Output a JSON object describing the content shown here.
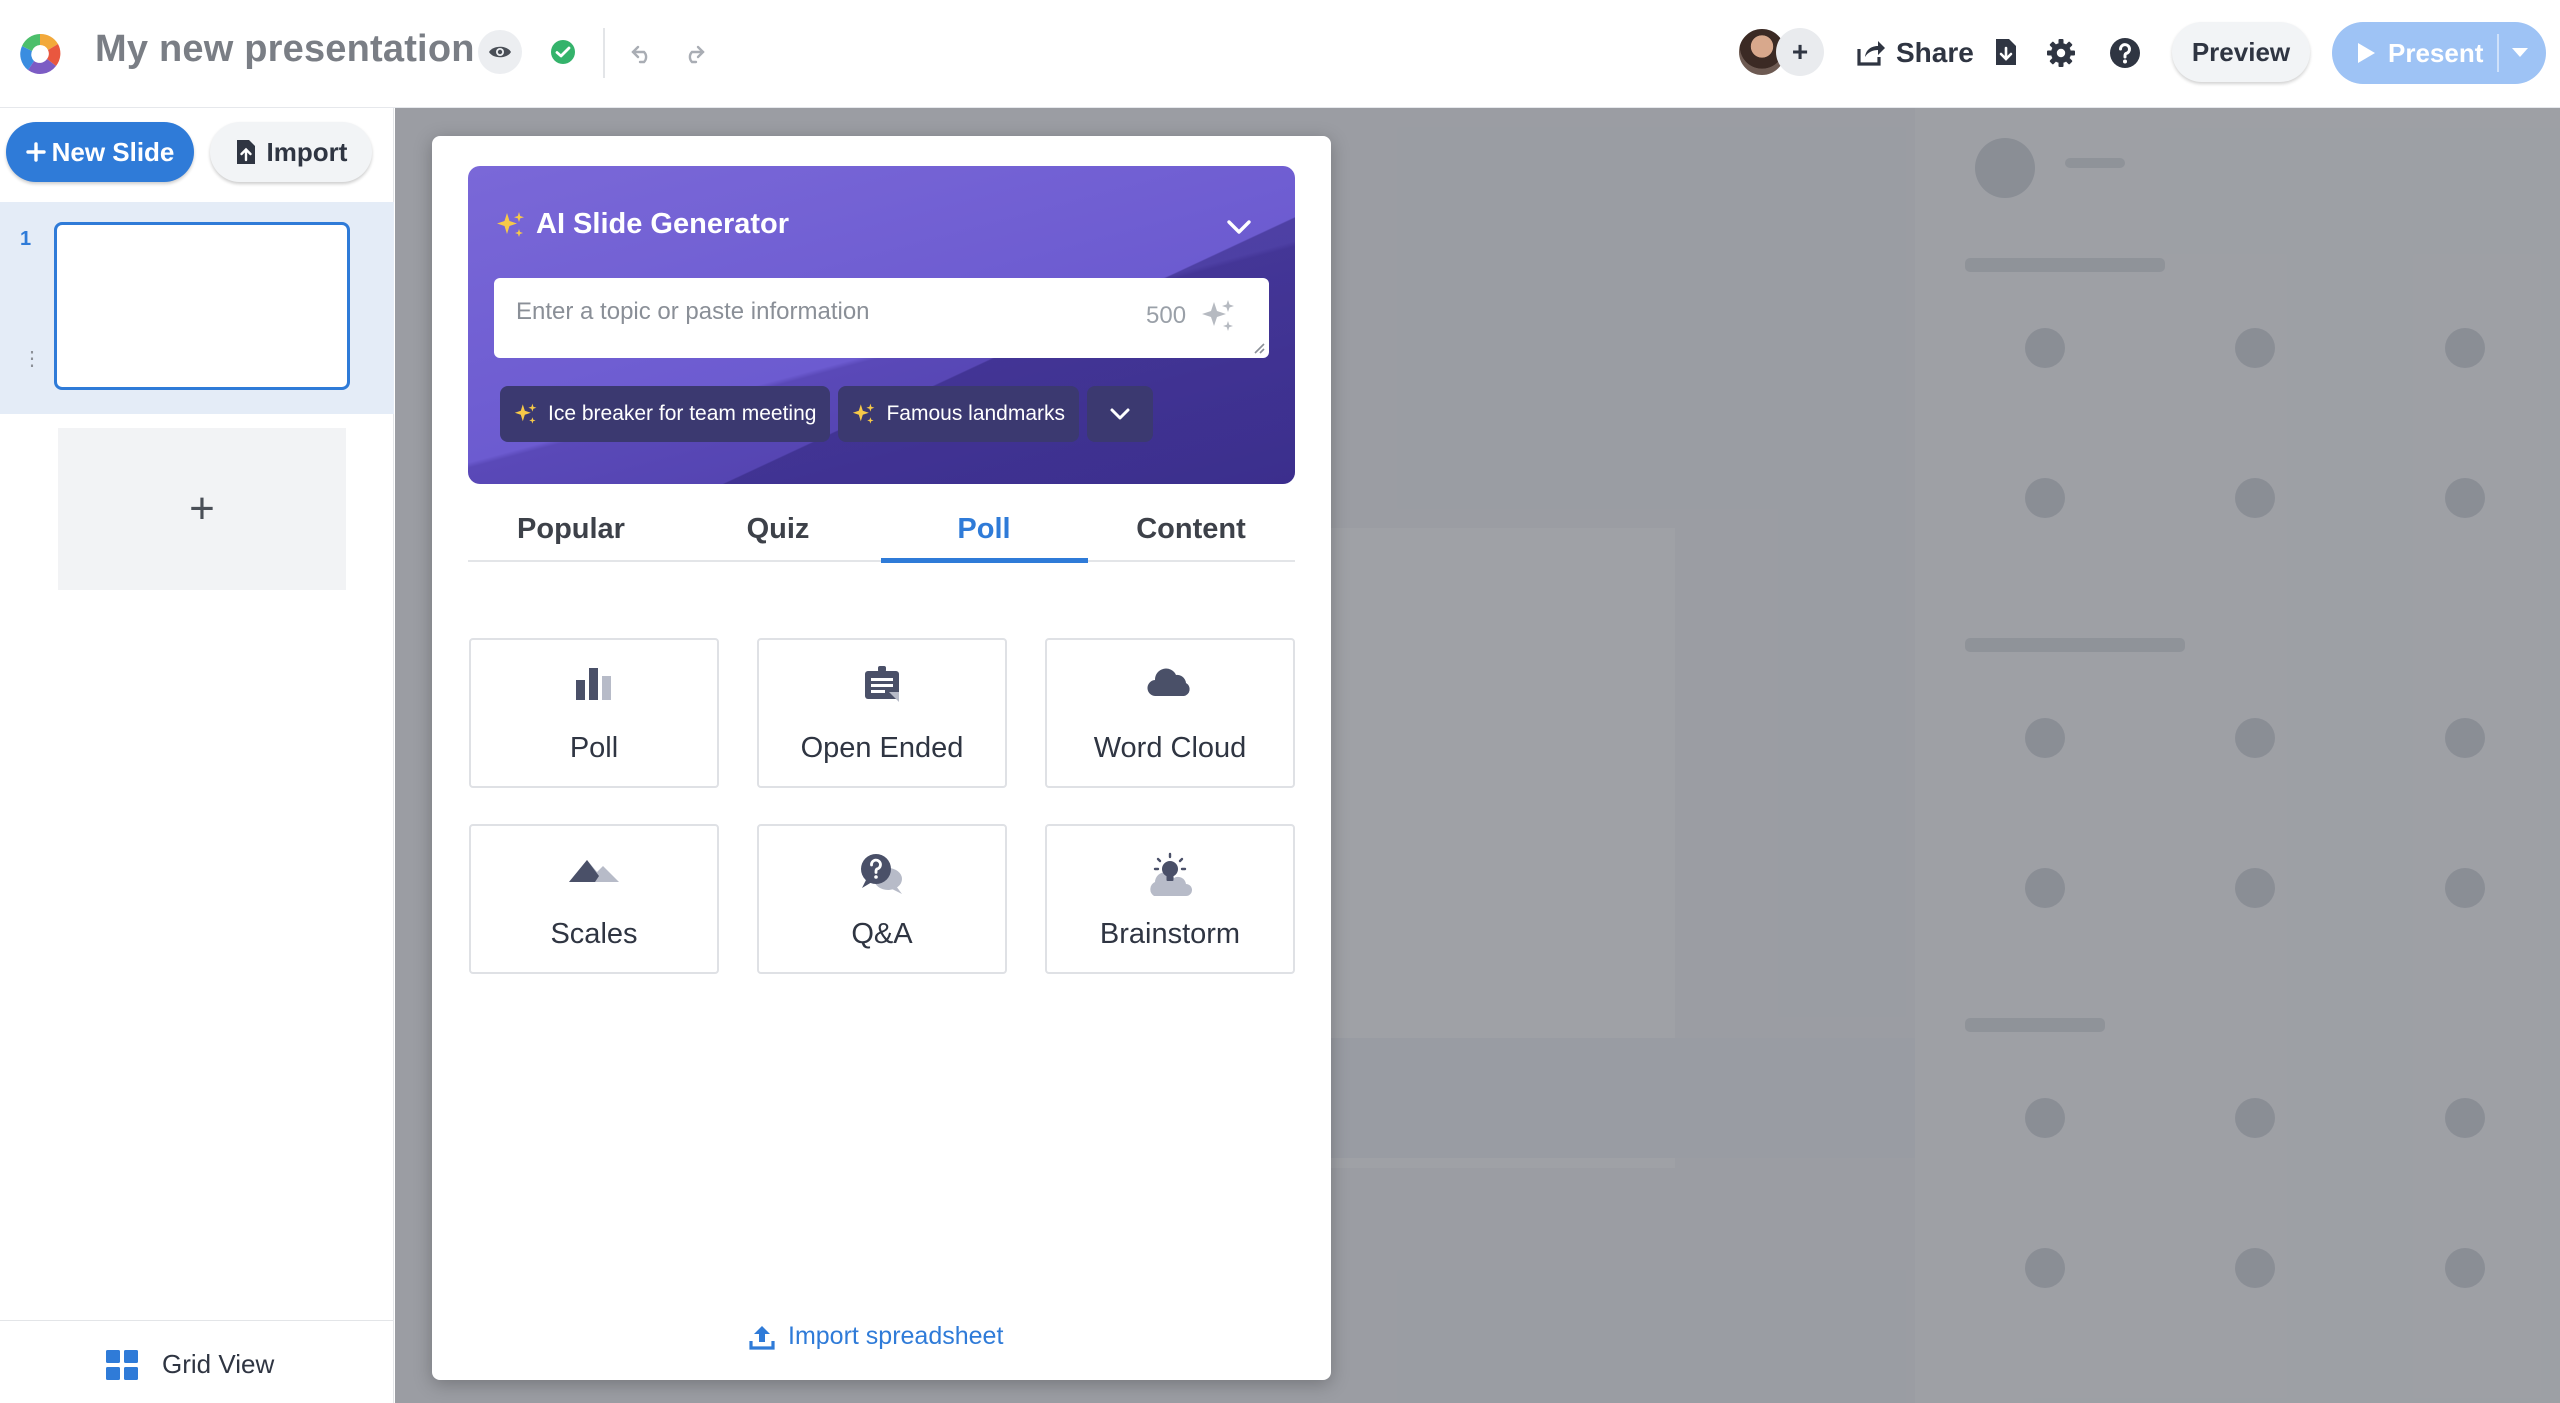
{
  "topbar": {
    "title": "My new presentation",
    "share_label": "Share",
    "preview_label": "Preview",
    "present_label": "Present",
    "avatar_add": "+"
  },
  "sidebar": {
    "new_slide_label": "New Slide",
    "import_label": "Import",
    "slides": [
      {
        "number": "1"
      }
    ],
    "add_slide_symbol": "+",
    "grid_view_label": "Grid View"
  },
  "modal": {
    "ai": {
      "title": "AI Slide Generator",
      "input_placeholder": "Enter a topic or paste information",
      "char_count": "500",
      "chips": [
        {
          "label": "Ice breaker for team meeting"
        },
        {
          "label": "Famous landmarks"
        }
      ]
    },
    "tabs": [
      {
        "label": "Popular"
      },
      {
        "label": "Quiz"
      },
      {
        "label": "Poll",
        "active": true
      },
      {
        "label": "Content"
      }
    ],
    "tiles": [
      {
        "label": "Poll",
        "icon": "bar-chart-icon"
      },
      {
        "label": "Open Ended",
        "icon": "open-ended-icon"
      },
      {
        "label": "Word Cloud",
        "icon": "cloud-icon"
      },
      {
        "label": "Scales",
        "icon": "scales-icon"
      },
      {
        "label": "Q&A",
        "icon": "qa-icon"
      },
      {
        "label": "Brainstorm",
        "icon": "lightbulb-icon"
      }
    ],
    "import_spreadsheet_label": "Import spreadsheet"
  },
  "colors": {
    "accent": "#2f7bd8",
    "ai_card": "#6c5bd0",
    "chip": "#3b3970",
    "present_disabled": "#9ec3f5",
    "success": "#34b36b"
  }
}
